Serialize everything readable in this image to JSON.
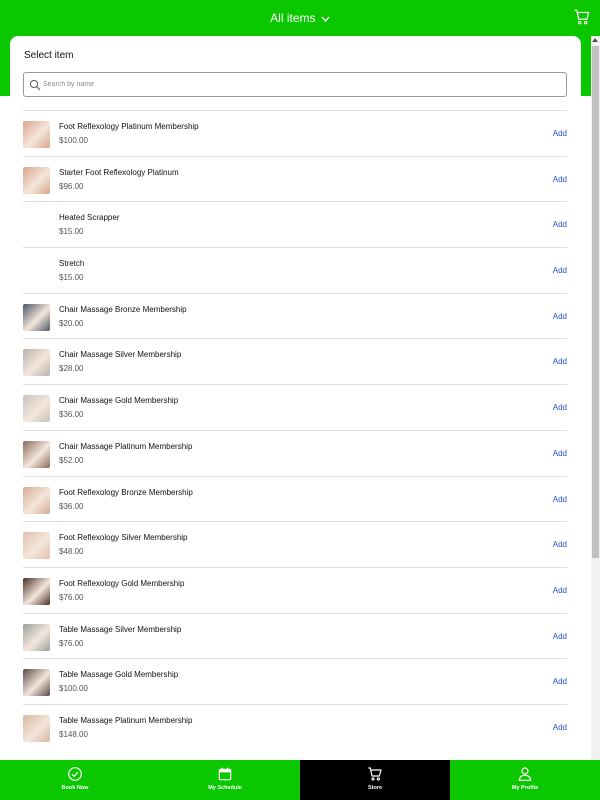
{
  "header": {
    "filter_label": "All items"
  },
  "card": {
    "title": "Select item",
    "search_placeholder": "Search by name",
    "add_label": "Add"
  },
  "items": [
    {
      "name": "Foot Reflexology Platinum Membership",
      "price": "$100.00",
      "thumb": "#d9a589"
    },
    {
      "name": "Starter Foot Reflexology Platinum",
      "price": "$96.00",
      "thumb": "#d9a589"
    },
    {
      "name": "Heated Scrapper",
      "price": "$15.00",
      "thumb": ""
    },
    {
      "name": "Stretch",
      "price": "$15.00",
      "thumb": ""
    },
    {
      "name": "Chair Massage Bronze Membership",
      "price": "$20.00",
      "thumb": "#4a5666"
    },
    {
      "name": "Chair Massage Silver Membership",
      "price": "$28.00",
      "thumb": "#b8b2ac"
    },
    {
      "name": "Chair Massage Gold Membership",
      "price": "$36.00",
      "thumb": "#c9c4bd"
    },
    {
      "name": "Chair Massage Platinum Membership",
      "price": "$52.00",
      "thumb": "#8a6a57"
    },
    {
      "name": "Foot Reflexology Bronze Membership",
      "price": "$36.00",
      "thumb": "#d8ab92"
    },
    {
      "name": "Foot Reflexology Silver Membership",
      "price": "$48.00",
      "thumb": "#e2c0aa"
    },
    {
      "name": "Foot Reflexology Gold Membership",
      "price": "$76.00",
      "thumb": "#4a2f24"
    },
    {
      "name": "Table Massage Silver Membership",
      "price": "$76.00",
      "thumb": "#9aa09a"
    },
    {
      "name": "Table Massage Gold Membership",
      "price": "$100.00",
      "thumb": "#5a4a42"
    },
    {
      "name": "Table Massage Platinum Membership",
      "price": "$148.00",
      "thumb": "#d9b6a0"
    }
  ],
  "bottom_nav": [
    {
      "label": "Book Now",
      "icon": "check-circle-icon"
    },
    {
      "label": "My Schedule",
      "icon": "calendar-icon"
    },
    {
      "label": "Store",
      "icon": "cart-icon"
    },
    {
      "label": "My Profile",
      "icon": "person-icon"
    }
  ],
  "colors": {
    "accent": "#0ac700",
    "link": "#1f4fd1",
    "active_tab": "#000000"
  }
}
